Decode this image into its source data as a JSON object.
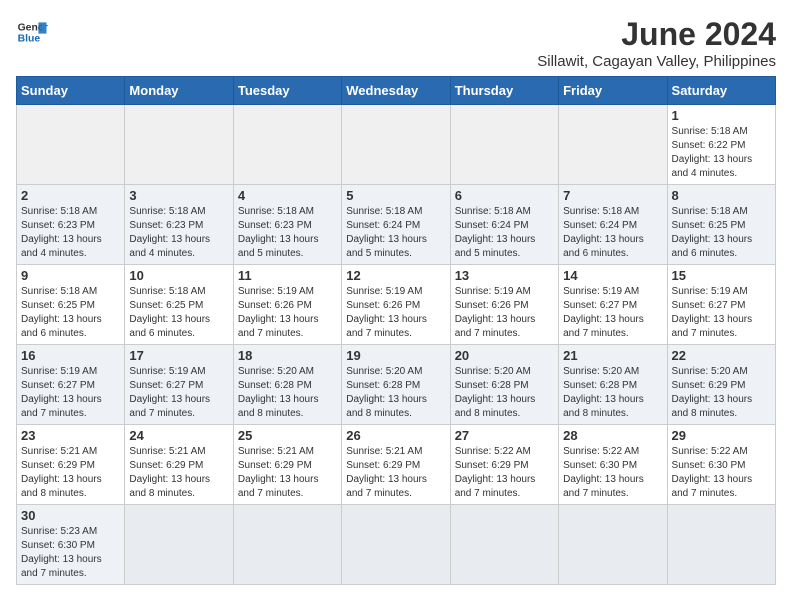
{
  "header": {
    "logo_general": "General",
    "logo_blue": "Blue",
    "month_year": "June 2024",
    "location": "Sillawit, Cagayan Valley, Philippines"
  },
  "days_of_week": [
    "Sunday",
    "Monday",
    "Tuesday",
    "Wednesday",
    "Thursday",
    "Friday",
    "Saturday"
  ],
  "weeks": [
    [
      {
        "day": "",
        "info": ""
      },
      {
        "day": "",
        "info": ""
      },
      {
        "day": "",
        "info": ""
      },
      {
        "day": "",
        "info": ""
      },
      {
        "day": "",
        "info": ""
      },
      {
        "day": "",
        "info": ""
      },
      {
        "day": "1",
        "info": "Sunrise: 5:18 AM\nSunset: 6:22 PM\nDaylight: 13 hours and 4 minutes."
      }
    ],
    [
      {
        "day": "2",
        "info": "Sunrise: 5:18 AM\nSunset: 6:23 PM\nDaylight: 13 hours and 4 minutes."
      },
      {
        "day": "3",
        "info": "Sunrise: 5:18 AM\nSunset: 6:23 PM\nDaylight: 13 hours and 4 minutes."
      },
      {
        "day": "4",
        "info": "Sunrise: 5:18 AM\nSunset: 6:23 PM\nDaylight: 13 hours and 5 minutes."
      },
      {
        "day": "5",
        "info": "Sunrise: 5:18 AM\nSunset: 6:24 PM\nDaylight: 13 hours and 5 minutes."
      },
      {
        "day": "6",
        "info": "Sunrise: 5:18 AM\nSunset: 6:24 PM\nDaylight: 13 hours and 5 minutes."
      },
      {
        "day": "7",
        "info": "Sunrise: 5:18 AM\nSunset: 6:24 PM\nDaylight: 13 hours and 6 minutes."
      },
      {
        "day": "8",
        "info": "Sunrise: 5:18 AM\nSunset: 6:25 PM\nDaylight: 13 hours and 6 minutes."
      }
    ],
    [
      {
        "day": "9",
        "info": "Sunrise: 5:18 AM\nSunset: 6:25 PM\nDaylight: 13 hours and 6 minutes."
      },
      {
        "day": "10",
        "info": "Sunrise: 5:18 AM\nSunset: 6:25 PM\nDaylight: 13 hours and 6 minutes."
      },
      {
        "day": "11",
        "info": "Sunrise: 5:19 AM\nSunset: 6:26 PM\nDaylight: 13 hours and 7 minutes."
      },
      {
        "day": "12",
        "info": "Sunrise: 5:19 AM\nSunset: 6:26 PM\nDaylight: 13 hours and 7 minutes."
      },
      {
        "day": "13",
        "info": "Sunrise: 5:19 AM\nSunset: 6:26 PM\nDaylight: 13 hours and 7 minutes."
      },
      {
        "day": "14",
        "info": "Sunrise: 5:19 AM\nSunset: 6:27 PM\nDaylight: 13 hours and 7 minutes."
      },
      {
        "day": "15",
        "info": "Sunrise: 5:19 AM\nSunset: 6:27 PM\nDaylight: 13 hours and 7 minutes."
      }
    ],
    [
      {
        "day": "16",
        "info": "Sunrise: 5:19 AM\nSunset: 6:27 PM\nDaylight: 13 hours and 7 minutes."
      },
      {
        "day": "17",
        "info": "Sunrise: 5:19 AM\nSunset: 6:27 PM\nDaylight: 13 hours and 7 minutes."
      },
      {
        "day": "18",
        "info": "Sunrise: 5:20 AM\nSunset: 6:28 PM\nDaylight: 13 hours and 8 minutes."
      },
      {
        "day": "19",
        "info": "Sunrise: 5:20 AM\nSunset: 6:28 PM\nDaylight: 13 hours and 8 minutes."
      },
      {
        "day": "20",
        "info": "Sunrise: 5:20 AM\nSunset: 6:28 PM\nDaylight: 13 hours and 8 minutes."
      },
      {
        "day": "21",
        "info": "Sunrise: 5:20 AM\nSunset: 6:28 PM\nDaylight: 13 hours and 8 minutes."
      },
      {
        "day": "22",
        "info": "Sunrise: 5:20 AM\nSunset: 6:29 PM\nDaylight: 13 hours and 8 minutes."
      }
    ],
    [
      {
        "day": "23",
        "info": "Sunrise: 5:21 AM\nSunset: 6:29 PM\nDaylight: 13 hours and 8 minutes."
      },
      {
        "day": "24",
        "info": "Sunrise: 5:21 AM\nSunset: 6:29 PM\nDaylight: 13 hours and 8 minutes."
      },
      {
        "day": "25",
        "info": "Sunrise: 5:21 AM\nSunset: 6:29 PM\nDaylight: 13 hours and 7 minutes."
      },
      {
        "day": "26",
        "info": "Sunrise: 5:21 AM\nSunset: 6:29 PM\nDaylight: 13 hours and 7 minutes."
      },
      {
        "day": "27",
        "info": "Sunrise: 5:22 AM\nSunset: 6:29 PM\nDaylight: 13 hours and 7 minutes."
      },
      {
        "day": "28",
        "info": "Sunrise: 5:22 AM\nSunset: 6:30 PM\nDaylight: 13 hours and 7 minutes."
      },
      {
        "day": "29",
        "info": "Sunrise: 5:22 AM\nSunset: 6:30 PM\nDaylight: 13 hours and 7 minutes."
      }
    ],
    [
      {
        "day": "30",
        "info": "Sunrise: 5:23 AM\nSunset: 6:30 PM\nDaylight: 13 hours and 7 minutes."
      },
      {
        "day": "",
        "info": ""
      },
      {
        "day": "",
        "info": ""
      },
      {
        "day": "",
        "info": ""
      },
      {
        "day": "",
        "info": ""
      },
      {
        "day": "",
        "info": ""
      },
      {
        "day": "",
        "info": ""
      }
    ]
  ]
}
